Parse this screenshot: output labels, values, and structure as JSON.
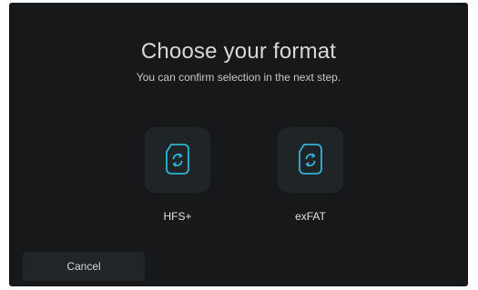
{
  "dialog": {
    "title": "Choose your format",
    "subtitle": "You can confirm selection in the next step."
  },
  "formats": [
    {
      "label": "HFS+",
      "icon": "format-disk-icon"
    },
    {
      "label": "exFAT",
      "icon": "format-disk-icon"
    }
  ],
  "actions": {
    "cancel_label": "Cancel"
  },
  "colors": {
    "background": "#16181a",
    "tile": "#1f2527",
    "accent": "#2fb3d6",
    "text": "#d8d8d8"
  }
}
